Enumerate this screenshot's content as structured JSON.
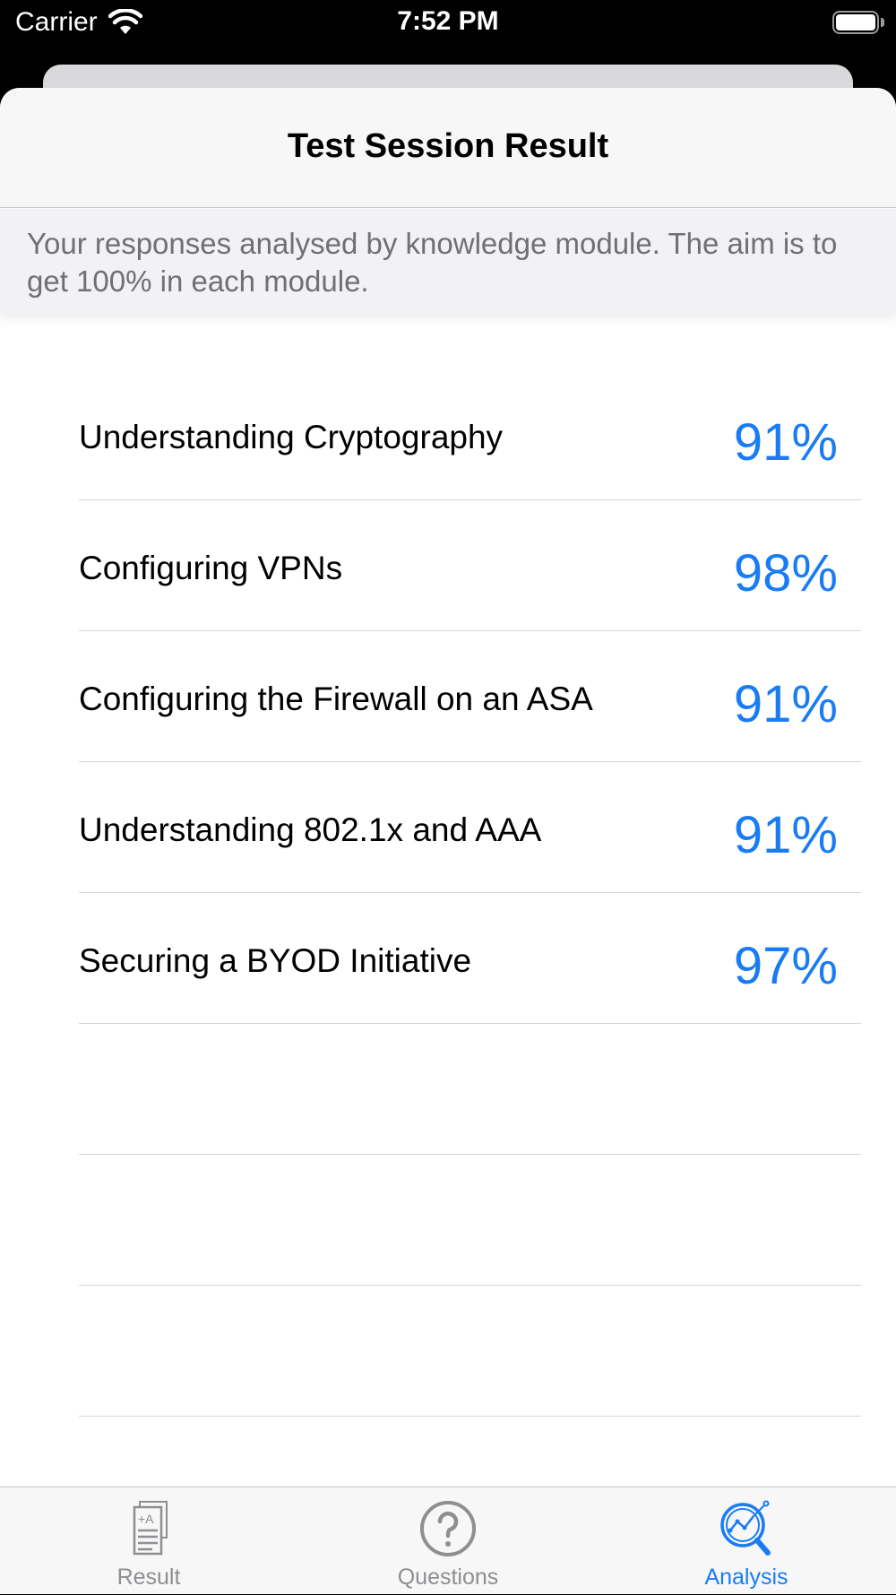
{
  "status_bar": {
    "carrier": "Carrier",
    "time": "7:52 PM"
  },
  "nav": {
    "title": "Test Session Result"
  },
  "banner": {
    "text": "Your responses analysed by knowledge module. The aim is to get 100% in each module."
  },
  "modules": [
    {
      "name": "Understanding Cryptography",
      "score": "91%"
    },
    {
      "name": "Configuring VPNs",
      "score": "98%"
    },
    {
      "name": "Configuring the Firewall on an ASA",
      "score": "91%"
    },
    {
      "name": "Understanding 802.1x and AAA",
      "score": "91%"
    },
    {
      "name": "Securing a BYOD Initiative",
      "score": "97%"
    },
    {
      "name": "",
      "score": ""
    },
    {
      "name": "",
      "score": ""
    },
    {
      "name": "",
      "score": ""
    }
  ],
  "tabs": [
    {
      "label": "Result",
      "icon": "result-document-icon",
      "active": false
    },
    {
      "label": "Questions",
      "icon": "question-circle-icon",
      "active": false
    },
    {
      "label": "Analysis",
      "icon": "analysis-magnifier-icon",
      "active": true
    }
  ],
  "colors": {
    "accent": "#1a7cf5",
    "inactive": "#8e8e93"
  }
}
